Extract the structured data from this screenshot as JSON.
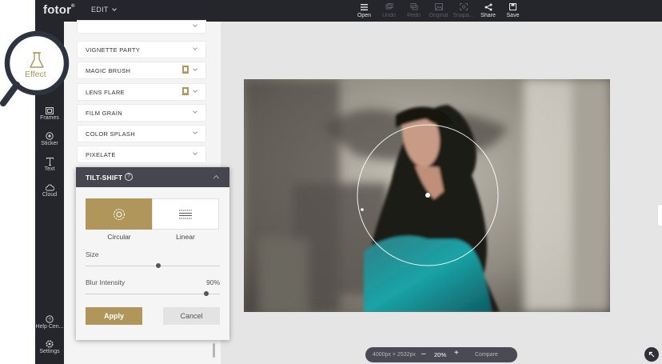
{
  "app": {
    "logo": "fotor",
    "logo_mark": "®",
    "menu": "EDIT"
  },
  "toolbar": [
    {
      "label": "Open",
      "icon": "menu-icon",
      "enabled": true
    },
    {
      "label": "Undo",
      "icon": "undo-icon",
      "enabled": false
    },
    {
      "label": "Redo",
      "icon": "redo-icon",
      "enabled": false
    },
    {
      "label": "Original",
      "icon": "image-icon",
      "enabled": false
    },
    {
      "label": "Snapa...",
      "icon": "snapshot-icon",
      "enabled": false
    },
    {
      "label": "Share",
      "icon": "share-icon",
      "enabled": true
    },
    {
      "label": "Save",
      "icon": "save-icon",
      "enabled": true
    }
  ],
  "sidebar": {
    "effect": "Effect",
    "frames": "Frames",
    "sticker": "Sticker",
    "text": "Text",
    "cloud": "Cloud",
    "help": "Help Cen...",
    "settings": "Settings"
  },
  "effects": [
    {
      "label": "VIGNETTE PARTY",
      "bookmark": false
    },
    {
      "label": "MAGIC BRUSH",
      "bookmark": true
    },
    {
      "label": "LENS FLARE",
      "bookmark": true
    },
    {
      "label": "FILM GRAIN",
      "bookmark": false
    },
    {
      "label": "COLOR SPLASH",
      "bookmark": false
    },
    {
      "label": "PIXELATE",
      "bookmark": false
    }
  ],
  "tilt_shift": {
    "title": "TILT-SHIFT",
    "help": "?",
    "modes": {
      "circular": "Circular",
      "linear": "Linear",
      "selected": "Circular"
    },
    "size": {
      "label": "Size",
      "value": 0.54
    },
    "blur": {
      "label": "Blur Intensity",
      "value_text": "90%",
      "value": 0.9
    },
    "apply": "Apply",
    "cancel": "Cancel"
  },
  "zoom": {
    "dimensions": "4000px × 2532px",
    "minus": "–",
    "percent": "20%",
    "plus": "+",
    "compare": "Compare"
  },
  "colors": {
    "accent": "#b0965a",
    "dark": "#25252c",
    "popup_header": "#464650"
  }
}
